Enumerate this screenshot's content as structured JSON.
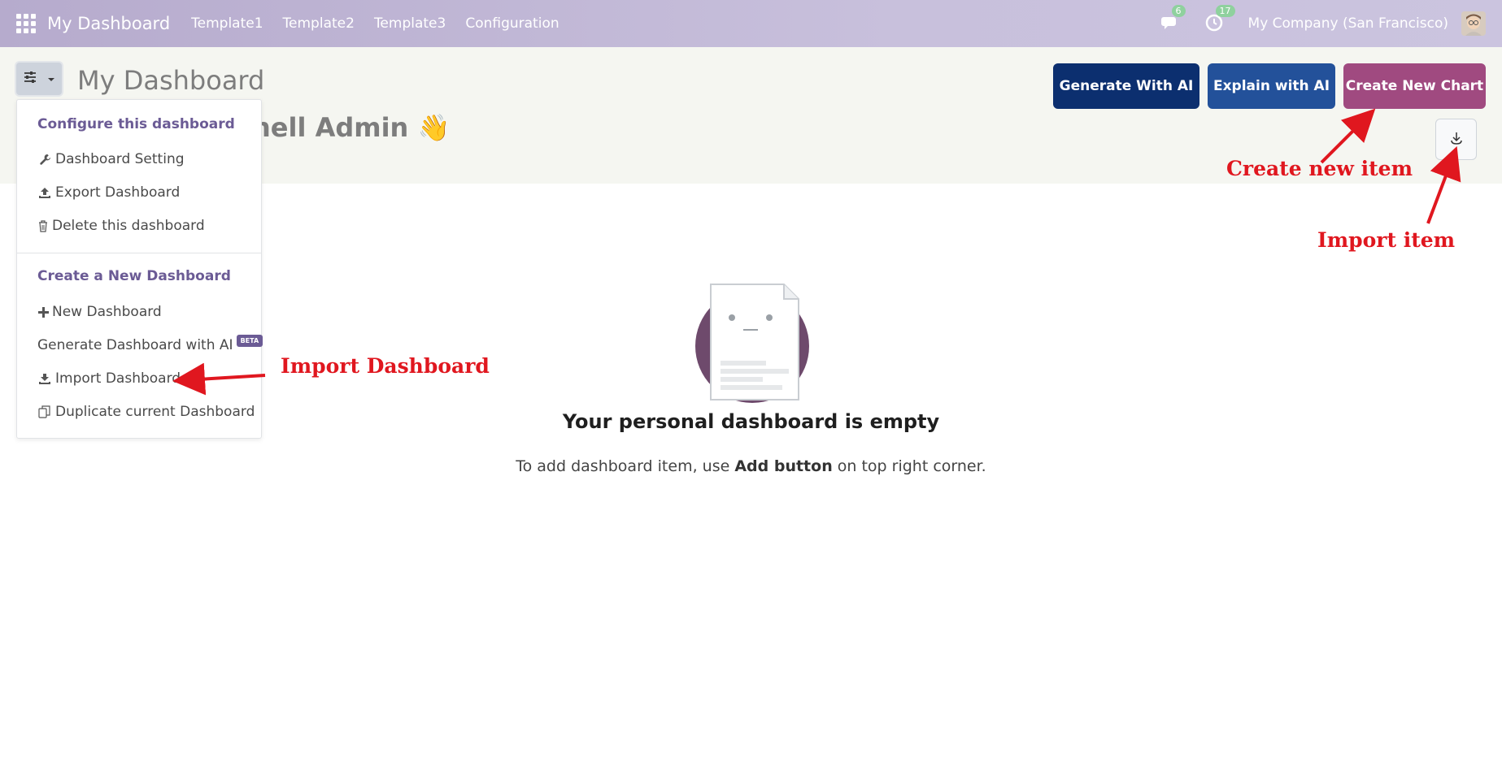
{
  "navbar": {
    "brand": "My Dashboard",
    "links": [
      "Template1",
      "Template2",
      "Template3",
      "Configuration"
    ],
    "messages_count": "6",
    "activities_count": "17",
    "company": "My Company (San Francisco)"
  },
  "header": {
    "title": "My Dashboard",
    "welcome": "nell Admin 👋",
    "buttons": {
      "generate_ai": "Generate With AI",
      "explain_ai": "Explain with AI",
      "create_chart": "Create New Chart"
    }
  },
  "dropdown": {
    "section1_header": "Configure this dashboard",
    "section1_items": [
      "Dashboard Setting",
      "Export Dashboard",
      "Delete this dashboard"
    ],
    "section2_header": "Create a New Dashboard",
    "section2_items": [
      "New Dashboard",
      "Generate Dashboard with AI",
      "Import Dashboard",
      "Duplicate current Dashboard"
    ],
    "beta_label": "BETA"
  },
  "empty_state": {
    "title": "Your personal dashboard is empty",
    "text_before": "To add dashboard item, use ",
    "text_bold": "Add button",
    "text_after": " on top right corner."
  },
  "annotations": {
    "create_new_item": "Create new item",
    "import_item": "Import item",
    "import_dashboard": "Import Dashboard"
  },
  "colors": {
    "navbar": "#c2b9d7",
    "generate_btn": "#0c2f6f",
    "explain_btn": "#23519a",
    "create_btn": "#a04a80",
    "annotation": "#e0171f",
    "dropdown_header": "#6b5b95"
  },
  "icons": {
    "apps": "apps-grid-icon",
    "messages": "chat-icon",
    "activities": "clock-icon",
    "filter": "sliders-icon",
    "import": "download-icon"
  }
}
